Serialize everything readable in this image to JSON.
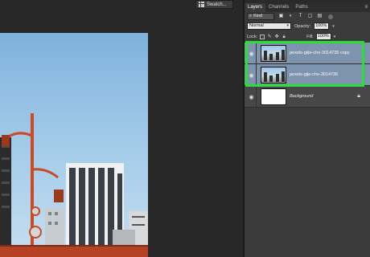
{
  "dock": {
    "swatches_label": "Swatch..."
  },
  "layers_panel": {
    "tabs": [
      {
        "label": "Layers",
        "active": true
      },
      {
        "label": "Channels",
        "active": false
      },
      {
        "label": "Paths",
        "active": false
      }
    ],
    "filter": {
      "kind_label": "Kind",
      "icons": [
        "image-filter-icon",
        "adjustment-filter-icon",
        "type-filter-icon",
        "shape-filter-icon",
        "smart-object-filter-icon"
      ]
    },
    "blend_mode": "Normal",
    "opacity_label": "Opacity:",
    "opacity_value": "100%",
    "lock_label": "Lock:",
    "fill_label": "Fill:",
    "fill_value": "100%",
    "layers": [
      {
        "name": "pexels-giije-cho-3014735 copy",
        "selected": true,
        "visible": true,
        "thumbnail": "photo"
      },
      {
        "name": "pexels-gije-cho-3014735",
        "selected": true,
        "visible": true,
        "thumbnail": "photo"
      },
      {
        "name": "Background",
        "selected": false,
        "visible": true,
        "thumbnail": "white",
        "locked": true
      }
    ]
  },
  "colors": {
    "highlight": "#2bde33",
    "selected_layer": "#7e93ae",
    "panel_bg": "#3b3b3b",
    "canvas_bg": "#282828"
  }
}
